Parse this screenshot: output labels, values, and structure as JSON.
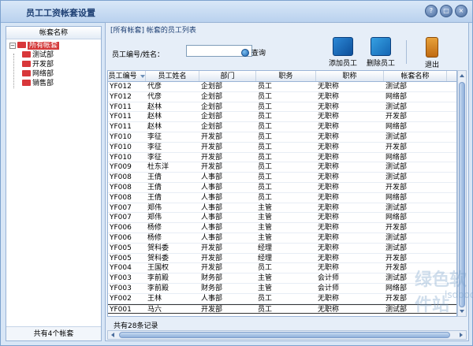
{
  "window": {
    "title": "员工工资帐套设置"
  },
  "sidebar": {
    "header": "帐套名称",
    "root_label": "所有帐套",
    "items": [
      {
        "label": "测试部"
      },
      {
        "label": "开发部"
      },
      {
        "label": "网络部"
      },
      {
        "label": "销售部"
      }
    ],
    "footer": "共有4个帐套"
  },
  "main": {
    "group_title": "[所有帐套] 帐套的员工列表",
    "search": {
      "label": "员工编号/姓名：",
      "value": "",
      "button_label": "查询"
    },
    "toolbar": {
      "add_label": "添加员工",
      "delete_label": "删除员工",
      "exit_label": "退出"
    },
    "columns": [
      "员工编号",
      "员工姓名",
      "部门",
      "职务",
      "职称",
      "帐套名称"
    ],
    "rows": [
      [
        "YF012",
        "代彦",
        "企划部",
        "员工",
        "无职称",
        "测试部"
      ],
      [
        "YF012",
        "代彦",
        "企划部",
        "员工",
        "无职称",
        "网络部"
      ],
      [
        "YF011",
        "赵林",
        "企划部",
        "员工",
        "无职称",
        "测试部"
      ],
      [
        "YF011",
        "赵林",
        "企划部",
        "员工",
        "无职称",
        "开发部"
      ],
      [
        "YF011",
        "赵林",
        "企划部",
        "员工",
        "无职称",
        "网络部"
      ],
      [
        "YF010",
        "李征",
        "开发部",
        "员工",
        "无职称",
        "测试部"
      ],
      [
        "YF010",
        "李征",
        "开发部",
        "员工",
        "无职称",
        "开发部"
      ],
      [
        "YF010",
        "李征",
        "开发部",
        "员工",
        "无职称",
        "网络部"
      ],
      [
        "YF009",
        "杜东洋",
        "开发部",
        "员工",
        "无职称",
        "测试部"
      ],
      [
        "YF008",
        "王倩",
        "人事部",
        "员工",
        "无职称",
        "测试部"
      ],
      [
        "YF008",
        "王倩",
        "人事部",
        "员工",
        "无职称",
        "开发部"
      ],
      [
        "YF008",
        "王倩",
        "人事部",
        "员工",
        "无职称",
        "网络部"
      ],
      [
        "YF007",
        "郑伟",
        "人事部",
        "主管",
        "无职称",
        "测试部"
      ],
      [
        "YF007",
        "郑伟",
        "人事部",
        "主管",
        "无职称",
        "网络部"
      ],
      [
        "YF006",
        "杨修",
        "人事部",
        "主管",
        "无职称",
        "开发部"
      ],
      [
        "YF006",
        "杨修",
        "人事部",
        "主管",
        "无职称",
        "测试部"
      ],
      [
        "YF005",
        "贺科委",
        "开发部",
        "经理",
        "无职称",
        "测试部"
      ],
      [
        "YF005",
        "贺科委",
        "开发部",
        "经理",
        "无职称",
        "开发部"
      ],
      [
        "YF004",
        "王国权",
        "开发部",
        "员工",
        "无职称",
        "开发部"
      ],
      [
        "YF003",
        "李前殿",
        "财务部",
        "主管",
        "会计师",
        "测试部"
      ],
      [
        "YF003",
        "李前殿",
        "财务部",
        "主管",
        "会计师",
        "网络部"
      ],
      [
        "YF002",
        "王林",
        "人事部",
        "员工",
        "无职称",
        "开发部"
      ],
      [
        "YF001",
        "马六",
        "开发部",
        "员工",
        "无职称",
        "测试部"
      ]
    ],
    "record_count": "共有28条记录"
  },
  "watermark": {
    "text": "绿色软件站",
    "sub": "lsdooo.com"
  },
  "colors": {
    "accent": "#1d3f73",
    "tree_selected": "#d43a3a",
    "folder": "#d8373a"
  }
}
